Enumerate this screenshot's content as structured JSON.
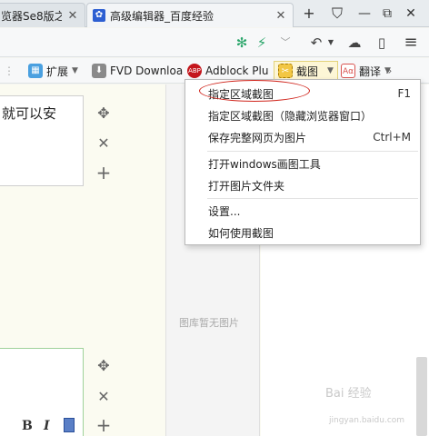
{
  "tabs": [
    {
      "title": "览器Se8版之",
      "close": "✕"
    },
    {
      "title": "高级编辑器_百度经验",
      "close": "✕",
      "favicon": "🐾"
    }
  ],
  "tabbar": {
    "new_tab": "+",
    "skin": "⛉",
    "restore": "⧉",
    "close": "✕"
  },
  "toolbar": {
    "refresh_icon": "✻",
    "flash_icon": "⚡",
    "undo_icon": "↶",
    "cloud_icon": "☁",
    "phone_icon": "▯",
    "menu_icon": "≡"
  },
  "extensions": {
    "ext_label": "扩展",
    "fvd_label": "FVD Downloa",
    "adblock_label": "Adblock Plu",
    "screenshot_label": "截图",
    "translate_label": "翻译",
    "more": "»"
  },
  "editor": {
    "text_snippet": "就可以安",
    "bold": "B",
    "italic": "I"
  },
  "gallery": {
    "empty_text": "图库暂无图片"
  },
  "watermark": {
    "text": "Bai 经验",
    "sub": "jingyan.baidu.com"
  },
  "screenshot_menu": {
    "items": [
      {
        "label": "指定区域截图",
        "shortcut": "F1"
      },
      {
        "label": "指定区域截图（隐藏浏览器窗口）",
        "shortcut": ""
      },
      {
        "label": "保存完整网页为图片",
        "shortcut": "Ctrl+M"
      },
      {
        "label": "打开windows画图工具",
        "shortcut": ""
      },
      {
        "label": "打开图片文件夹",
        "shortcut": ""
      },
      {
        "label": "设置...",
        "shortcut": ""
      },
      {
        "label": "如何使用截图",
        "shortcut": ""
      }
    ]
  },
  "colors": {
    "highlight_ring": "#d0241b",
    "accent": "#2d5fd2"
  }
}
